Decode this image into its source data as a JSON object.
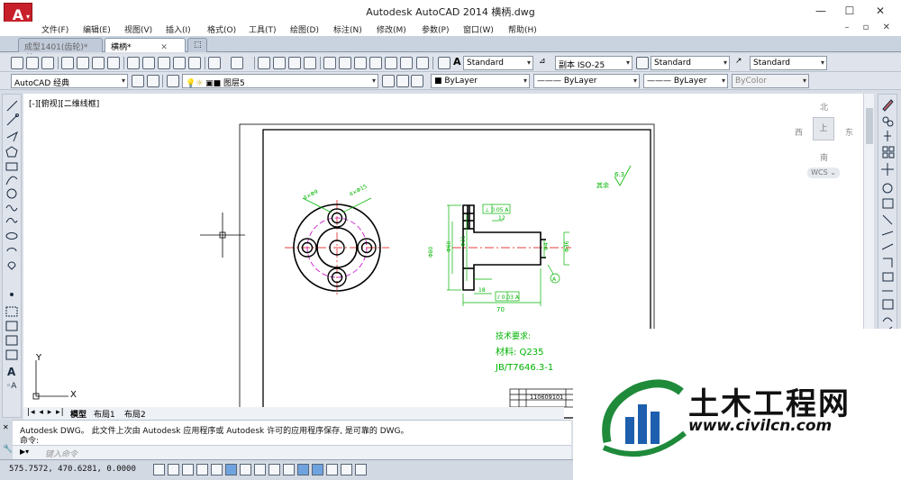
{
  "titlebar": {
    "title": "Autodesk AutoCAD 2014    横柄.dwg",
    "logo_letter": "A"
  },
  "menu": [
    "文件(F)",
    "编辑(E)",
    "视图(V)",
    "插入(I)",
    "格式(O)",
    "工具(T)",
    "绘图(D)",
    "标注(N)",
    "修改(M)",
    "参数(P)",
    "窗口(W)",
    "帮助(H)"
  ],
  "doc_tabs": {
    "tab1": "成型1401(齿轮)*",
    "tab2": "横柄*"
  },
  "toolbar1": {
    "text_style": "Standard",
    "dim_style": "副本 ISO-25",
    "table_style": "Standard",
    "multileader_style": "Standard"
  },
  "toolbar2": {
    "workspace": "AutoCAD 经典",
    "layer": "图层5",
    "color": "ByLayer",
    "linetype": "ByLayer",
    "lineweight": "ByLayer",
    "plotstyle": "ByColor"
  },
  "viewport": {
    "label": "[-][俯视][二维线框]"
  },
  "viewcube": {
    "north": "北",
    "south": "南",
    "west": "西",
    "east": "东",
    "center": "上",
    "wcs": "WCS ⌄"
  },
  "ucs": {
    "x": "X",
    "y": "Y"
  },
  "drawing": {
    "roughness_note": "其余",
    "roughness_value": "6.3",
    "tech_req": "技术要求:",
    "material": "材料: Q235",
    "standard": "JB/T7646.3-1",
    "part_no": "110609101",
    "dim_70": "70",
    "dim_18": "18",
    "dim_12": "12"
  },
  "layout_tabs": {
    "model": "模型",
    "layout1": "布局1",
    "layout2": "布局2"
  },
  "command": {
    "line1": "Autodesk DWG。  此文件上次由 Autodesk 应用程序或 Autodesk 许可的应用程序保存, 是可靠的 DWG。",
    "line2": "命令:",
    "placeholder": "键入命令"
  },
  "status": {
    "coords": "575.7572, 470.6281, 0.0000"
  },
  "watermark": {
    "cn": "土木工程网",
    "url": "www.civilcn.com"
  },
  "colors": {
    "accent_red": "#c8202b",
    "dim_green": "#00b400",
    "center_red": "#e00000",
    "hidden_magenta": "#c800c8"
  }
}
